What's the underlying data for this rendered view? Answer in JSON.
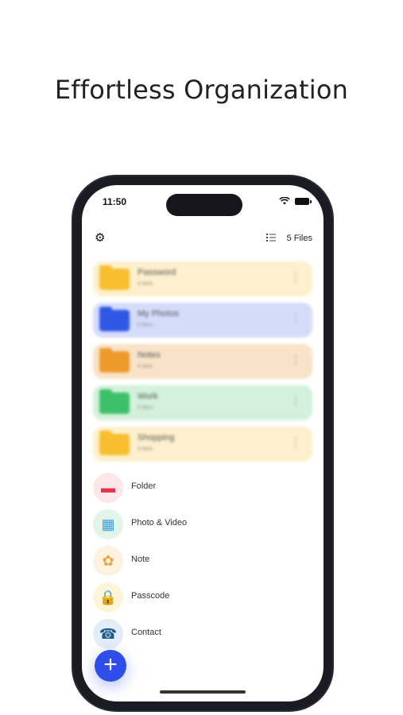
{
  "headline": "Effortless Organization",
  "status_bar": {
    "time": "11:50"
  },
  "toolbar": {
    "files_count": "5 Files"
  },
  "folders": [
    {
      "name": "Password",
      "sub": "0 item",
      "bg": "#fdf0cc",
      "color": "#f7bf2e"
    },
    {
      "name": "My Photos",
      "sub": "0 item",
      "bg": "#d5dcfb",
      "color": "#3056e6"
    },
    {
      "name": "Notes",
      "sub": "0 item",
      "bg": "#f8e3c8",
      "color": "#ee9a2b"
    },
    {
      "name": "Work",
      "sub": "0 item",
      "bg": "#d3f1dc",
      "color": "#3ec06a"
    },
    {
      "name": "Shopping",
      "sub": "0 item",
      "bg": "#fdf0cc",
      "color": "#f7bf2e"
    }
  ],
  "actions": [
    {
      "label": "Folder",
      "icon": "folder-icon",
      "glyph": "▬",
      "color": "#e8334f",
      "bg": "#fde7ea"
    },
    {
      "label": "Photo & Video",
      "icon": "photo-icon",
      "glyph": "▦",
      "color": "#3aa0d8",
      "bg": "#e3f5ea"
    },
    {
      "label": "Note",
      "icon": "note-icon",
      "glyph": "✿",
      "color": "#f0a43a",
      "bg": "#fdf1e0"
    },
    {
      "label": "Passcode",
      "icon": "lock-icon",
      "glyph": "🔒",
      "color": "#e8a21e",
      "bg": "#fdf5d8"
    },
    {
      "label": "Contact",
      "icon": "phone-icon",
      "glyph": "☎",
      "color": "#1f5a8a",
      "bg": "#e2edf7"
    }
  ],
  "fab": {
    "glyph": "+"
  }
}
